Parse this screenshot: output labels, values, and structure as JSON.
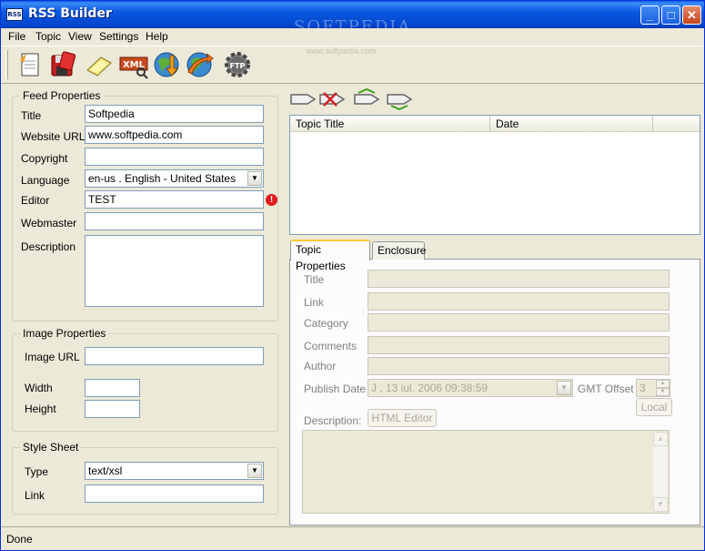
{
  "window": {
    "title": "RSS Builder",
    "icon_label": "RSS",
    "watermark": "SOFTPEDIA",
    "watermark_url": "www.softpedia.com",
    "minimize": "_",
    "maximize": "□",
    "close": "✕"
  },
  "menu": [
    "File",
    "Topic",
    "View",
    "Settings",
    "Help"
  ],
  "toolbar": {
    "icons": [
      "new-feed-icon",
      "save-icon",
      "open-icon",
      "xml-icon",
      "download-icon",
      "publish-icon",
      "ftp-icon"
    ],
    "ftp_label": "FTP",
    "xml_label": "XML"
  },
  "feed_properties": {
    "title": "Feed Properties",
    "labels": {
      "title": "Title",
      "website_url": "Website URL",
      "copyright": "Copyright",
      "language": "Language",
      "editor": "Editor",
      "webmaster": "Webmaster",
      "description": "Description"
    },
    "values": {
      "title": "Softpedia",
      "website_url": "www.softpedia.com",
      "copyright": "",
      "language": "en-us . English - United States",
      "editor": "TEST",
      "webmaster": "",
      "description": ""
    },
    "error_glyph": "!"
  },
  "image_properties": {
    "title": "Image Properties",
    "labels": {
      "image_url": "Image URL",
      "width": "Width",
      "height": "Height"
    },
    "values": {
      "image_url": "",
      "width": "",
      "height": ""
    }
  },
  "style_sheet": {
    "title": "Style Sheet",
    "labels": {
      "type": "Type",
      "link": "Link"
    },
    "values": {
      "type": "text/xsl",
      "link": ""
    }
  },
  "topics_list": {
    "columns": [
      "Topic Title",
      "Date"
    ],
    "rows": []
  },
  "tabs": [
    "Topic Properties",
    "Enclosure"
  ],
  "topic_properties": {
    "labels": {
      "title": "Title",
      "link": "Link",
      "category": "Category",
      "comments": "Comments",
      "author": "Author",
      "publish_date": "Publish Date",
      "gmt_offset": "GMT Offset",
      "description": "Description:"
    },
    "values": {
      "title": "",
      "link": "",
      "category": "",
      "comments": "",
      "author": "",
      "publish_date": "J  , 13  iul.  2006 09:38:59",
      "gmt_offset": "3",
      "description": ""
    },
    "buttons": {
      "local": "Local",
      "html_editor": "HTML Editor"
    }
  },
  "status": {
    "text": "Done"
  },
  "colors": {
    "titlebar": "#0a58e0",
    "window_bg": "#ece9d8",
    "field_border": "#7f9db9",
    "error": "#e01b1b"
  }
}
